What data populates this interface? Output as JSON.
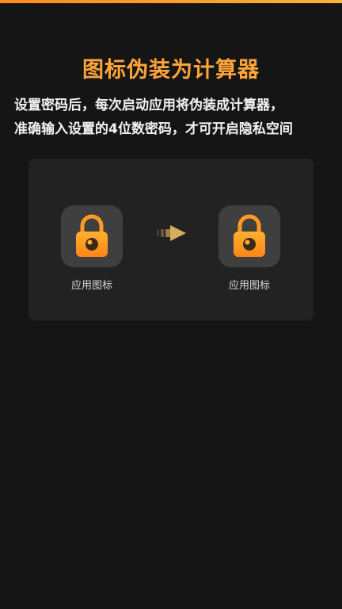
{
  "header": {
    "title": "图标伪装为计算器"
  },
  "description": {
    "line1": "设置密码后，每次启动应用将伪装成计算器，",
    "line2": "准确输入设置的4位数密码，才可开启隐私空间"
  },
  "demo": {
    "before": {
      "label": "应用图标",
      "icon": "lock-icon"
    },
    "after": {
      "label": "应用图标",
      "icon": "lock-icon"
    },
    "arrow_icon": "arrow-right-icon"
  },
  "colors": {
    "accent": "#ffa53a",
    "background": "#151515",
    "card": "#222222",
    "icon_tile": "#3f3f3f"
  }
}
